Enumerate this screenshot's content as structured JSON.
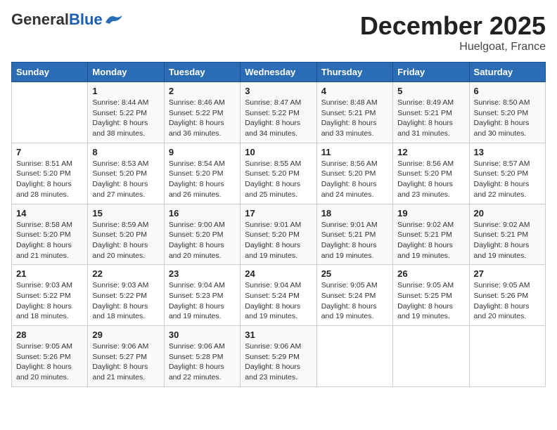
{
  "header": {
    "logo_general": "General",
    "logo_blue": "Blue",
    "month": "December 2025",
    "location": "Huelgoat, France"
  },
  "columns": [
    "Sunday",
    "Monday",
    "Tuesday",
    "Wednesday",
    "Thursday",
    "Friday",
    "Saturday"
  ],
  "weeks": [
    [
      {
        "day": "",
        "info": ""
      },
      {
        "day": "1",
        "info": "Sunrise: 8:44 AM\nSunset: 5:22 PM\nDaylight: 8 hours\nand 38 minutes."
      },
      {
        "day": "2",
        "info": "Sunrise: 8:46 AM\nSunset: 5:22 PM\nDaylight: 8 hours\nand 36 minutes."
      },
      {
        "day": "3",
        "info": "Sunrise: 8:47 AM\nSunset: 5:22 PM\nDaylight: 8 hours\nand 34 minutes."
      },
      {
        "day": "4",
        "info": "Sunrise: 8:48 AM\nSunset: 5:21 PM\nDaylight: 8 hours\nand 33 minutes."
      },
      {
        "day": "5",
        "info": "Sunrise: 8:49 AM\nSunset: 5:21 PM\nDaylight: 8 hours\nand 31 minutes."
      },
      {
        "day": "6",
        "info": "Sunrise: 8:50 AM\nSunset: 5:20 PM\nDaylight: 8 hours\nand 30 minutes."
      }
    ],
    [
      {
        "day": "7",
        "info": "Sunrise: 8:51 AM\nSunset: 5:20 PM\nDaylight: 8 hours\nand 28 minutes."
      },
      {
        "day": "8",
        "info": "Sunrise: 8:53 AM\nSunset: 5:20 PM\nDaylight: 8 hours\nand 27 minutes."
      },
      {
        "day": "9",
        "info": "Sunrise: 8:54 AM\nSunset: 5:20 PM\nDaylight: 8 hours\nand 26 minutes."
      },
      {
        "day": "10",
        "info": "Sunrise: 8:55 AM\nSunset: 5:20 PM\nDaylight: 8 hours\nand 25 minutes."
      },
      {
        "day": "11",
        "info": "Sunrise: 8:56 AM\nSunset: 5:20 PM\nDaylight: 8 hours\nand 24 minutes."
      },
      {
        "day": "12",
        "info": "Sunrise: 8:56 AM\nSunset: 5:20 PM\nDaylight: 8 hours\nand 23 minutes."
      },
      {
        "day": "13",
        "info": "Sunrise: 8:57 AM\nSunset: 5:20 PM\nDaylight: 8 hours\nand 22 minutes."
      }
    ],
    [
      {
        "day": "14",
        "info": "Sunrise: 8:58 AM\nSunset: 5:20 PM\nDaylight: 8 hours\nand 21 minutes."
      },
      {
        "day": "15",
        "info": "Sunrise: 8:59 AM\nSunset: 5:20 PM\nDaylight: 8 hours\nand 20 minutes."
      },
      {
        "day": "16",
        "info": "Sunrise: 9:00 AM\nSunset: 5:20 PM\nDaylight: 8 hours\nand 20 minutes."
      },
      {
        "day": "17",
        "info": "Sunrise: 9:01 AM\nSunset: 5:20 PM\nDaylight: 8 hours\nand 19 minutes."
      },
      {
        "day": "18",
        "info": "Sunrise: 9:01 AM\nSunset: 5:21 PM\nDaylight: 8 hours\nand 19 minutes."
      },
      {
        "day": "19",
        "info": "Sunrise: 9:02 AM\nSunset: 5:21 PM\nDaylight: 8 hours\nand 19 minutes."
      },
      {
        "day": "20",
        "info": "Sunrise: 9:02 AM\nSunset: 5:21 PM\nDaylight: 8 hours\nand 19 minutes."
      }
    ],
    [
      {
        "day": "21",
        "info": "Sunrise: 9:03 AM\nSunset: 5:22 PM\nDaylight: 8 hours\nand 18 minutes."
      },
      {
        "day": "22",
        "info": "Sunrise: 9:03 AM\nSunset: 5:22 PM\nDaylight: 8 hours\nand 18 minutes."
      },
      {
        "day": "23",
        "info": "Sunrise: 9:04 AM\nSunset: 5:23 PM\nDaylight: 8 hours\nand 19 minutes."
      },
      {
        "day": "24",
        "info": "Sunrise: 9:04 AM\nSunset: 5:24 PM\nDaylight: 8 hours\nand 19 minutes."
      },
      {
        "day": "25",
        "info": "Sunrise: 9:05 AM\nSunset: 5:24 PM\nDaylight: 8 hours\nand 19 minutes."
      },
      {
        "day": "26",
        "info": "Sunrise: 9:05 AM\nSunset: 5:25 PM\nDaylight: 8 hours\nand 19 minutes."
      },
      {
        "day": "27",
        "info": "Sunrise: 9:05 AM\nSunset: 5:26 PM\nDaylight: 8 hours\nand 20 minutes."
      }
    ],
    [
      {
        "day": "28",
        "info": "Sunrise: 9:05 AM\nSunset: 5:26 PM\nDaylight: 8 hours\nand 20 minutes."
      },
      {
        "day": "29",
        "info": "Sunrise: 9:06 AM\nSunset: 5:27 PM\nDaylight: 8 hours\nand 21 minutes."
      },
      {
        "day": "30",
        "info": "Sunrise: 9:06 AM\nSunset: 5:28 PM\nDaylight: 8 hours\nand 22 minutes."
      },
      {
        "day": "31",
        "info": "Sunrise: 9:06 AM\nSunset: 5:29 PM\nDaylight: 8 hours\nand 23 minutes."
      },
      {
        "day": "",
        "info": ""
      },
      {
        "day": "",
        "info": ""
      },
      {
        "day": "",
        "info": ""
      }
    ]
  ]
}
